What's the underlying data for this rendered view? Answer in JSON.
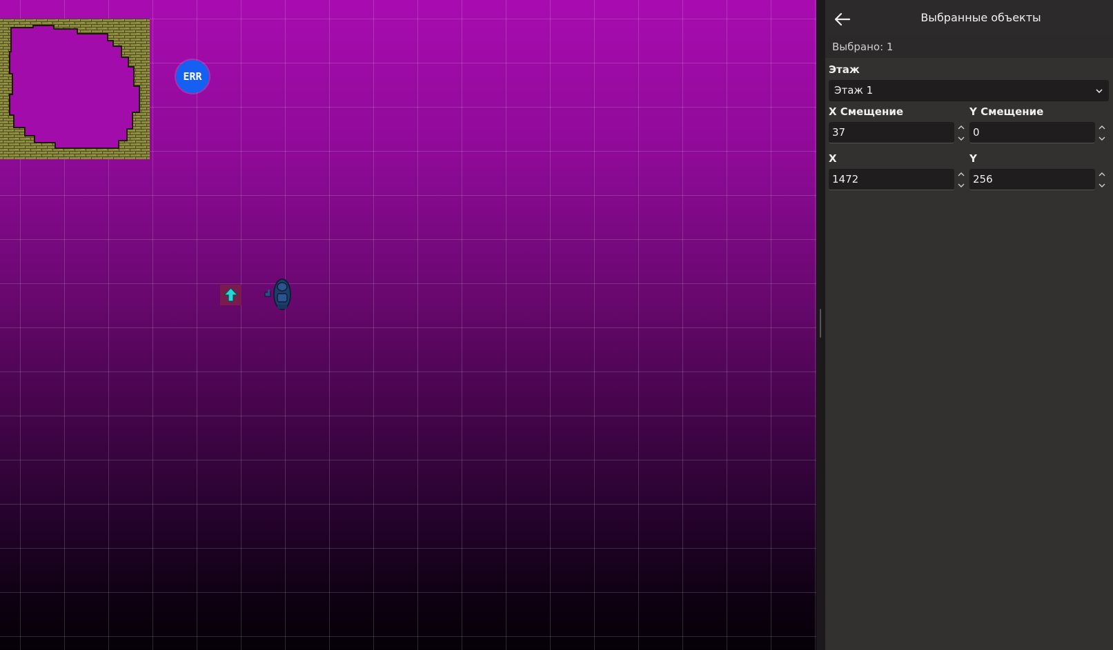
{
  "canvas": {
    "err_badge_text": "ERR",
    "background_top_color": "#a80cb0",
    "background_bottom_color": "#050007",
    "wall_color": "#8a8a3a"
  },
  "panel": {
    "back_icon": "arrow-left-icon",
    "title": "Выбранные объекты",
    "selected_count": "Выбрано: 1",
    "floor": {
      "label": "Этаж",
      "value": "Этаж 1"
    },
    "x_offset": {
      "label": "X Смещение",
      "value": "37"
    },
    "y_offset": {
      "label": "Y Смещение",
      "value": "0"
    },
    "x": {
      "label": "X",
      "value": "1472"
    },
    "y": {
      "label": "Y",
      "value": "256"
    }
  }
}
